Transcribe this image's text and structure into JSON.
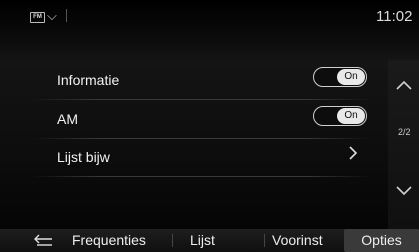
{
  "status": {
    "source_badge": "FM",
    "clock": "11:02"
  },
  "settings": {
    "items": [
      {
        "label": "Informatie",
        "toggle": "On"
      },
      {
        "label": "AM",
        "toggle": "On"
      },
      {
        "label": "Lijst bijw"
      }
    ]
  },
  "scroll": {
    "page_indicator": "2/2"
  },
  "tabs": {
    "frequencies": "Frequenties",
    "list": "Lijst",
    "presets": "Voorinst",
    "options": "Opties"
  },
  "colors": {
    "background": "#000000",
    "active_tab": "#3a3a3a",
    "toggle_on": "#e9e9e9"
  }
}
